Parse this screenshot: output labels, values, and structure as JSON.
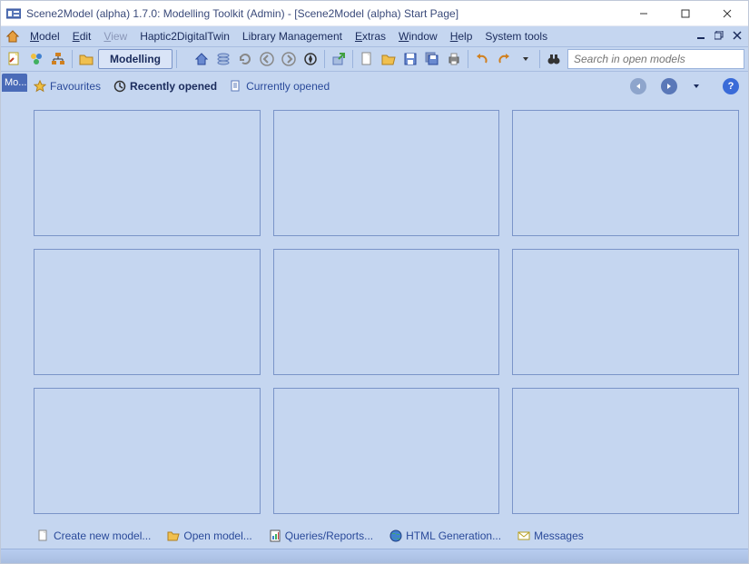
{
  "titlebar": {
    "title": "Scene2Model (alpha) 1.7.0: Modelling Toolkit (Admin) - [Scene2Model (alpha) Start Page]"
  },
  "menu": {
    "items": [
      {
        "label": "Model",
        "ul": "M",
        "rest": "odel"
      },
      {
        "label": "Edit",
        "ul": "E",
        "rest": "dit"
      },
      {
        "label": "View",
        "ul": "V",
        "rest": "iew",
        "disabled": true
      },
      {
        "label": "Haptic2DigitalTwin",
        "ul": "",
        "rest": "Haptic2DigitalTwin"
      },
      {
        "label": "Library Management",
        "ul": "",
        "rest": "Library Management"
      },
      {
        "label": "Extras",
        "ul": "E",
        "rest": "xtras"
      },
      {
        "label": "Window",
        "ul": "W",
        "rest": "indow"
      },
      {
        "label": "Help",
        "ul": "H",
        "rest": "elp"
      },
      {
        "label": "System tools",
        "ul": "",
        "rest": "System tools"
      }
    ]
  },
  "toolbar": {
    "mode": "Modelling",
    "search_placeholder": "Search in open models"
  },
  "sidebar": {
    "tab": "Mo..."
  },
  "content_tabs": {
    "favourites": "Favourites",
    "recently": "Recently opened",
    "currently": "Currently opened"
  },
  "bottom_links": {
    "create": "Create new model...",
    "open": "Open model...",
    "queries": "Queries/Reports...",
    "html": "HTML Generation...",
    "messages": "Messages"
  }
}
